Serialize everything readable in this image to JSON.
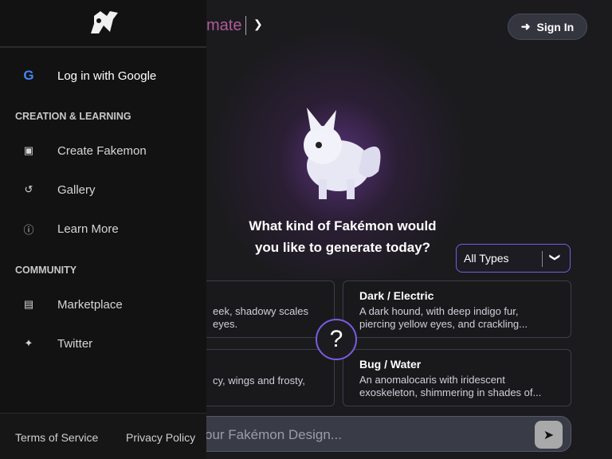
{
  "header": {
    "title_fragment": "mate",
    "sign_in": "Sign In"
  },
  "main": {
    "question": "What kind of Fakémon would you like to generate today?",
    "type_filter": "All Types",
    "cards": [
      {
        "title": "",
        "desc": "eek, shadowy scales eyes."
      },
      {
        "title": "Dark / Electric",
        "desc": "A dark hound, with deep indigo fur, piercing yellow eyes, and crackling..."
      },
      {
        "title": "",
        "desc": "cy, wings and frosty,"
      },
      {
        "title": "Bug / Water",
        "desc": "An anomalocaris with iridescent exoskeleton, shimmering in shades of..."
      }
    ],
    "random_button": "?",
    "input_placeholder": "our Fakémon Design..."
  },
  "sidebar": {
    "login": "Log in with Google",
    "sections": [
      "CREATION & LEARNING",
      "COMMUNITY"
    ],
    "items": [
      {
        "label": "Create Fakemon",
        "icon": "image-icon"
      },
      {
        "label": "Gallery",
        "icon": "history-icon"
      },
      {
        "label": "Learn More",
        "icon": "info-icon"
      },
      {
        "label": "Marketplace",
        "icon": "store-icon"
      },
      {
        "label": "Twitter",
        "icon": "twitter-icon"
      }
    ],
    "footer": {
      "terms": "Terms of Service",
      "privacy": "Privacy Policy"
    }
  },
  "colors": {
    "accent": "#7b5ce0",
    "sidebar_bg": "#121212"
  }
}
